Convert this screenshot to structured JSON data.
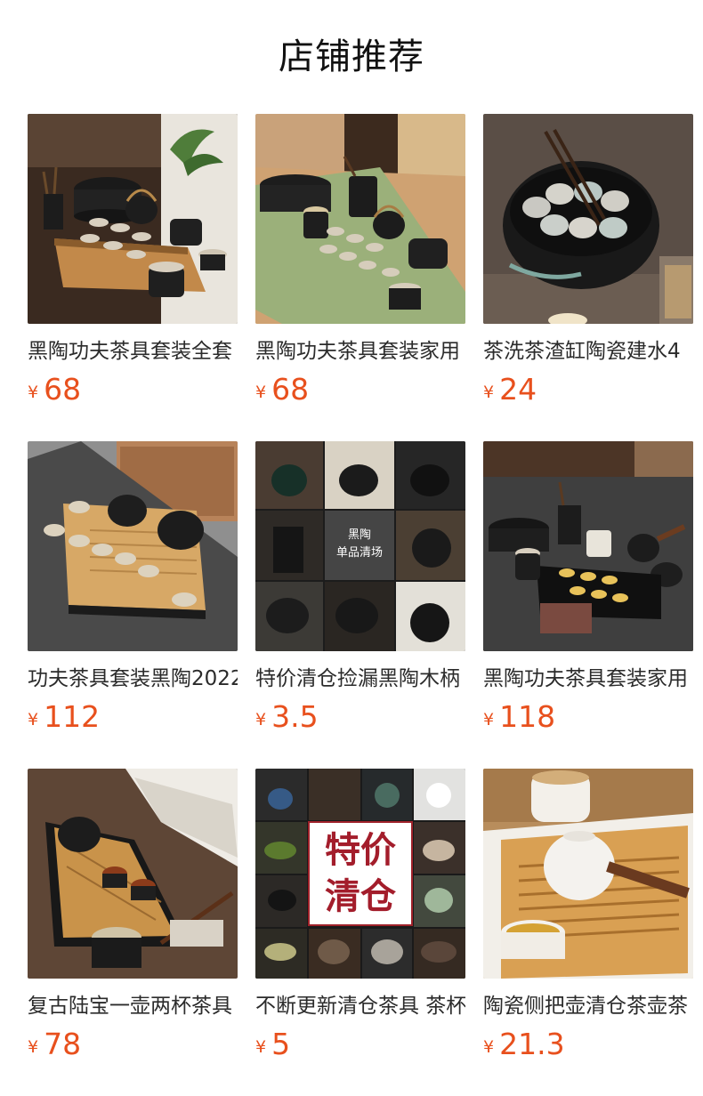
{
  "page": {
    "title": "店铺推荐"
  },
  "currency": "¥",
  "accent_color": "#e8501d",
  "products": [
    {
      "name": "黑陶功夫茶具套装全套",
      "price": "68"
    },
    {
      "name": "黑陶功夫茶具套装家用",
      "price": "68"
    },
    {
      "name": "茶洗茶渣缸陶瓷建水4",
      "price": "24"
    },
    {
      "name": "功夫茶具套装黑陶2022",
      "price": "112"
    },
    {
      "name": "特价清仓捡漏黑陶木柄",
      "price": "3.5"
    },
    {
      "name": "黑陶功夫茶具套装家用",
      "price": "118"
    },
    {
      "name": "复古陆宝一壶两杯茶具",
      "price": "78"
    },
    {
      "name": "不断更新清仓茶具 茶杯",
      "price": "5"
    },
    {
      "name": "陶瓷侧把壶清仓茶壶茶",
      "price": "21.3"
    }
  ],
  "overlays": {
    "p5_line1": "黑陶",
    "p5_line2": "单品清场",
    "p8_line1": "特价",
    "p8_line2": "清仓"
  }
}
